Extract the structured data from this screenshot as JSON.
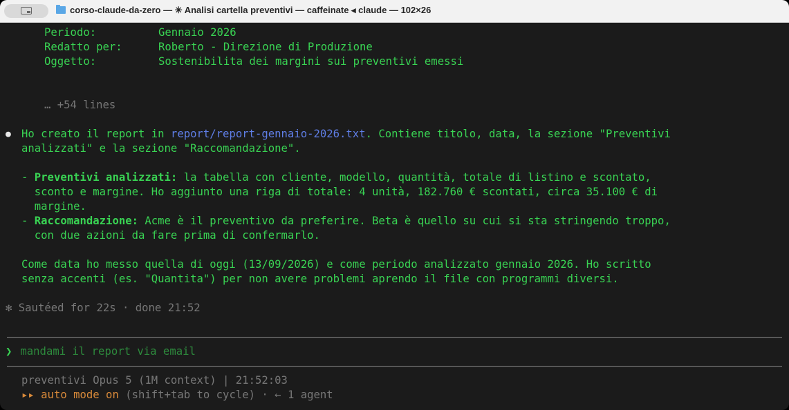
{
  "window": {
    "title": "corso-claude-da-zero — ✳ Analisi cartella preventivi — caffeinate ◂ claude — 102×26"
  },
  "header_block": {
    "periodo_label": "Periodo:",
    "periodo_value": "Gennaio 2026",
    "redatto_label": "Redatto per:",
    "redatto_value": "Roberto - Direzione di Produzione",
    "oggetto_label": "Oggetto:",
    "oggetto_value": "Sostenibilita dei margini sui preventivi emessi",
    "more_lines": "… +54 lines"
  },
  "message": {
    "bullet": "●",
    "line1_a": "Ho creato il report in ",
    "line1_link": "report/report-gennaio-2026.txt",
    "line1_b": ". Contiene titolo, data, la sezione \"Preventivi",
    "line2": "analizzati\" e la sezione \"Raccomandazione\".",
    "item1_dash": "- ",
    "item1_title": "Preventivi analizzati:",
    "item1_l1": " la tabella con cliente, modello, quantità, totale di listino e scontato,",
    "item1_l2": "  sconto e margine. Ho aggiunto una riga di totale: 4 unità, 182.760 € scontati, circa 35.100 € di",
    "item1_l3": "  margine.",
    "item2_dash": "- ",
    "item2_title": "Raccomandazione:",
    "item2_l1": " Acme è il preventivo da preferire. Beta è quello su cui si sta stringendo troppo,",
    "item2_l2": "  con due azioni da fare prima di confermarlo.",
    "para_l1": "Come data ho messo quella di oggi (13/09/2026) e come periodo analizzato gennaio 2026. Ho scritto",
    "para_l2": "senza accenti (es. \"Quantita\") per non avere problemi aprendo il file con programmi diversi."
  },
  "status": {
    "icon": "✻",
    "text": "Sautéed for 22s · done 21:52"
  },
  "prompt": {
    "symbol": "❯",
    "input": "mandami il report via email"
  },
  "footer": {
    "line1": "preventivi Opus 5 (1M context) | 21:52:03",
    "mode_icon": "▸▸",
    "mode_text": "auto mode on",
    "mode_hint": "(shift+tab to cycle) · ← 1 agent"
  },
  "colors": {
    "text": "#39d353",
    "link": "#5f7ee6",
    "dim": "#777777",
    "amber": "#d98a3a",
    "background": "#1b1b1b"
  }
}
